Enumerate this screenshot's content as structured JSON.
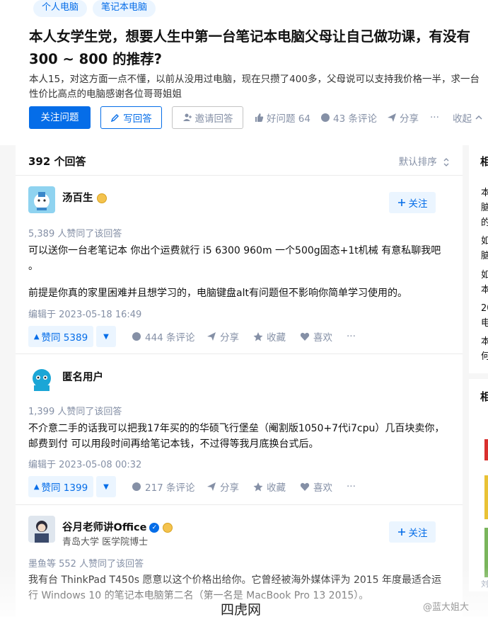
{
  "topics": [
    "个人电脑",
    "笔记本电脑"
  ],
  "question": {
    "title": "本人女学生党，想要人生中第一台笔记本电脑父母让自己做功课，有没有 300 ~ 800 的推荐?",
    "description": "本人15，对这方面一点不懂，以前从没用过电脑，现在只攒了400多，父母说可以支持我价格一半，求一台性价比高点的电脑感谢各位哥哥姐姐"
  },
  "question_actions": {
    "follow": "关注问题",
    "write": "写回答",
    "invite": "邀请回答",
    "good_question": "好问题 64",
    "comments": "43 条评论",
    "share": "分享",
    "more": "···",
    "collapse": "收起"
  },
  "answers_header": {
    "count": "392 个回答",
    "sort": "默认排序"
  },
  "answers": [
    {
      "author": "汤百生",
      "upvote_info": "5,389 人赞同了该回答",
      "paragraphs": [
        "可以送你一台老笔记本 你出个运费就行 i5 6300 960m 一个500g固态+1t机械 有意私聊我吧 。",
        "前提是你真的家里困难并且想学习的，电脑键盘alt有问题但不影响你简单学习使用的。"
      ],
      "edit_time": "编辑于 2023-05-18 16:49",
      "vote": "赞同 5389",
      "comments": "444 条评论",
      "share": "分享",
      "collect": "收藏",
      "like": "喜欢",
      "more": "···",
      "follow": "关注"
    },
    {
      "author": "匿名用户",
      "upvote_info": "1,399 人赞同了该回答",
      "paragraphs": [
        "不介意二手的话我可以把我17年买的的华硕飞行堡垒（阉割版1050+7代i7cpu）几百块卖你，邮费到付 可以用段时间再给笔记本钱，不过得等我月底换台式后。"
      ],
      "edit_time": "编辑于 2023-05-08 00:32",
      "vote": "赞同 1399",
      "comments": "217 条评论",
      "share": "分享",
      "collect": "收藏",
      "like": "喜欢",
      "more": "···"
    },
    {
      "author": "谷月老师讲Office",
      "subtitle": "青岛大学 医学院博士",
      "upvote_info": "墨鱼等 552 人赞同了该回答",
      "paragraphs": [
        "我有台 ThinkPad T450s 愿意以这个价格出给你。它曾经被海外媒体评为 2015 年度最适合运行 Windows 10 的笔记本电脑第二名（第一名是 MacBook Pro 13 2015）。"
      ],
      "follow": "关注"
    }
  ],
  "sidebar": {
    "head1": "相",
    "lines1": [
      "本",
      "脑",
      "的",
      "如",
      "脑",
      "如",
      "本",
      "20",
      "电",
      "本",
      "何"
    ],
    "head2": "相",
    "bottom": "刘看"
  },
  "watermark": {
    "left": "四虎网",
    "right": "@蓝大姐大"
  },
  "colors": {
    "accent": "#056de8",
    "accent_light": "#ebf5ff",
    "muted": "#8590a6"
  }
}
